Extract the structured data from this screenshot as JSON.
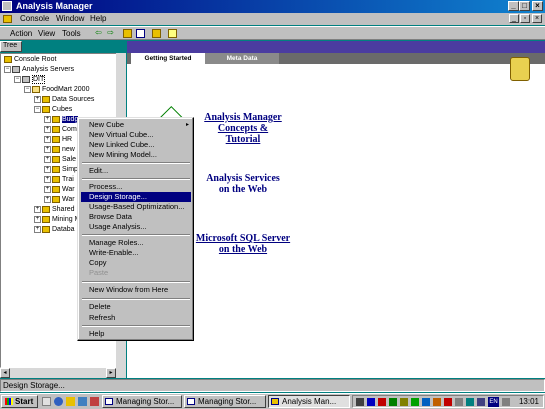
{
  "window": {
    "title": "Analysis Manager"
  },
  "menubar": {
    "items": [
      "Console",
      "Window",
      "Help"
    ]
  },
  "toolbar": {
    "items": [
      "Action",
      "View",
      "Tools"
    ]
  },
  "tree": {
    "tab_label": "Tree",
    "nodes": [
      "Console Root",
      "Analysis Servers",
      "DIT",
      "FoodMart 2000",
      "Data Sources",
      "Cubes",
      "Budg",
      "Com",
      "HR",
      "new",
      "Sale",
      "Simp",
      "Trai",
      "War",
      "War",
      "Shared",
      "Mining M",
      "Databa"
    ]
  },
  "pane": {
    "tabs": [
      "Getting Started",
      "Meta Data"
    ],
    "links": [
      {
        "lines": [
          "Analysis Manager",
          "Concepts &",
          "Tutorial"
        ]
      },
      {
        "lines": [
          "Analysis Services",
          "on the Web"
        ]
      },
      {
        "lines": [
          "Microsoft SQL Server",
          "on the Web"
        ]
      }
    ]
  },
  "context_menu": {
    "items": [
      "New Cube",
      "New Virtual Cube...",
      "New Linked Cube...",
      "New Mining Model...",
      "Edit...",
      "Process...",
      "Design Storage...",
      "Usage-Based Optimization...",
      "Browse Data",
      "Usage Analysis...",
      "Manage Roles...",
      "Write-Enable...",
      "Copy",
      "Paste",
      "New Window from Here",
      "Delete",
      "Refresh",
      "Help"
    ],
    "highlighted": "Design Storage..."
  },
  "statusbar": {
    "text": "Design Storage..."
  },
  "taskbar": {
    "start_label": "Start",
    "buttons": [
      "Managing Stor...",
      "Managing Stor...",
      "Analysis Man..."
    ],
    "tray_lang": "EN",
    "clock": "13:01"
  },
  "colors": {
    "title_active": "#000080",
    "highlight": "#000080",
    "banner": "#4b3ca0",
    "desktop": "#008080"
  }
}
